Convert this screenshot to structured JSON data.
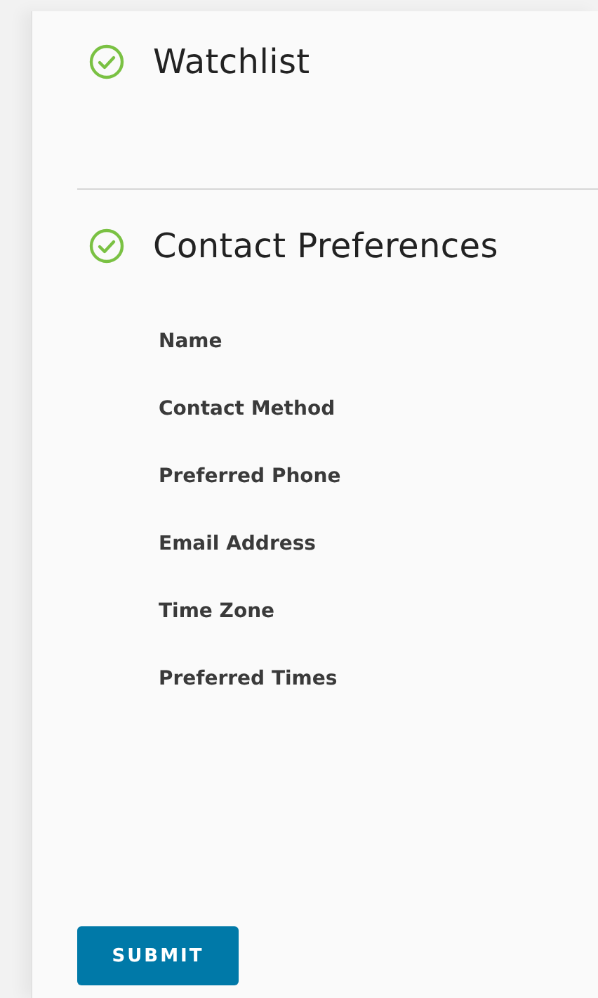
{
  "sections": [
    {
      "title": "Watchlist",
      "completed": true
    },
    {
      "title": "Contact Preferences",
      "completed": true,
      "fields": [
        "Name",
        "Contact Method",
        "Preferred Phone",
        "Email Address",
        "Time Zone",
        "Preferred Times"
      ]
    }
  ],
  "submit_button": "SUBMIT"
}
